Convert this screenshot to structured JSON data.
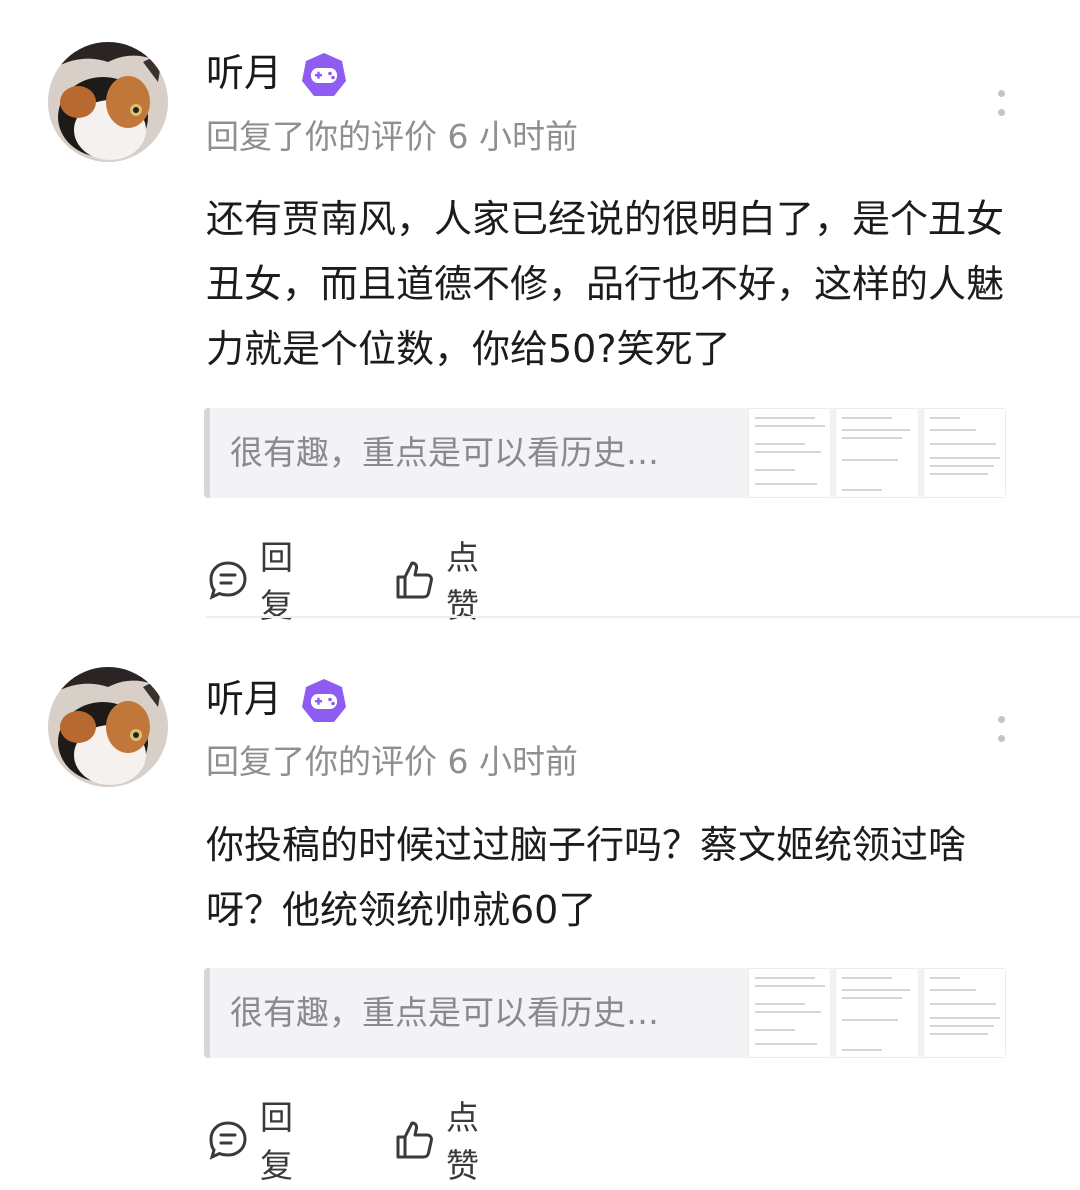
{
  "comments": [
    {
      "username": "听月",
      "badge_icon": "game-controller-icon",
      "meta": "回复了你的评价 6 小时前",
      "body": "还有贾南风，人家已经说的很明白了，是个丑女丑女，而且道德不修，品行也不好，这样的人魅力就是个位数，你给50?笑死了",
      "quote": "很有趣，重点是可以看历史…",
      "reply_label": "回复",
      "like_label": "点赞"
    },
    {
      "username": "听月",
      "badge_icon": "game-controller-icon",
      "meta": "回复了你的评价 6 小时前",
      "body": "你投稿的时候过过脑子行吗？蔡文姬统领过啥呀？他统领统帅就60了",
      "quote": "很有趣，重点是可以看历史…",
      "reply_label": "回复",
      "like_label": "点赞"
    }
  ],
  "colors": {
    "badge": "#8e5cf0",
    "meta": "#8e8e93",
    "quote_bg": "#f3f3f5"
  }
}
